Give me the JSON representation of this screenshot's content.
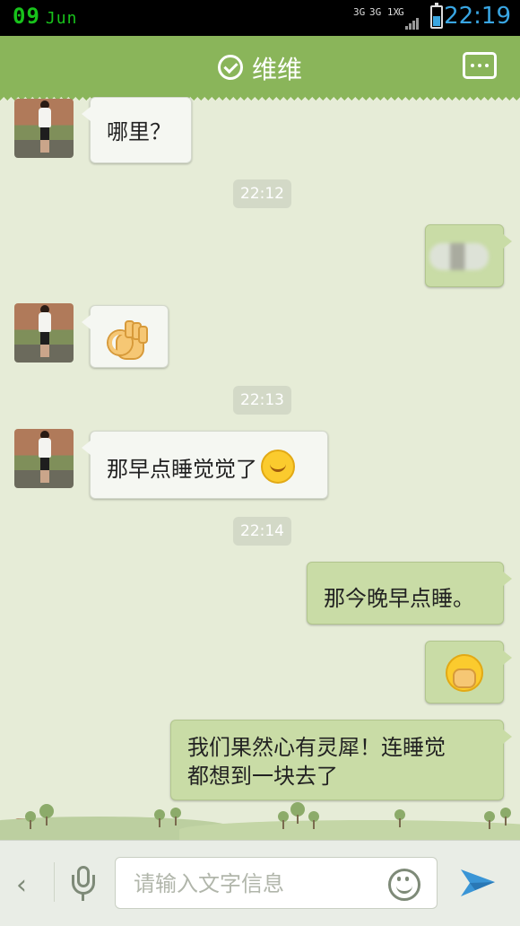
{
  "status_bar": {
    "date": "09",
    "month": "Jun",
    "network_labels": [
      "3G",
      "3G 1X",
      "G"
    ],
    "time": "22:19"
  },
  "header": {
    "title": "维维",
    "title_icon": "check-circle-icon",
    "menu_icon": "more-icon"
  },
  "messages": [
    {
      "type": "text",
      "side": "in",
      "text": "哪里？"
    },
    {
      "type": "timestamp",
      "text": "22:12"
    },
    {
      "type": "image",
      "side": "out",
      "content": "blurred-image"
    },
    {
      "type": "emoji",
      "side": "in",
      "emoji": "ok-hand-emoji"
    },
    {
      "type": "timestamp",
      "text": "22:13"
    },
    {
      "type": "text",
      "side": "in",
      "text": "那早点睡觉觉了",
      "emoji": "smile-emoji"
    },
    {
      "type": "timestamp",
      "text": "22:14"
    },
    {
      "type": "text",
      "side": "out",
      "text": "那今晚早点睡。"
    },
    {
      "type": "emoji",
      "side": "out",
      "emoji": "shy-emoji"
    },
    {
      "type": "text",
      "side": "out",
      "line1": "我们果然心有灵犀！连睡觉",
      "line2": "都想到一块去了"
    }
  ],
  "input_bar": {
    "back_label": "‹",
    "placeholder": "请输入文字信息",
    "value": ""
  },
  "colors": {
    "header": "#8ab55a",
    "chat_bg": "#e6ecd7",
    "out_bubble": "#c9dca6",
    "in_bubble": "#f5f7f2",
    "time_accent": "#39a6e3"
  }
}
